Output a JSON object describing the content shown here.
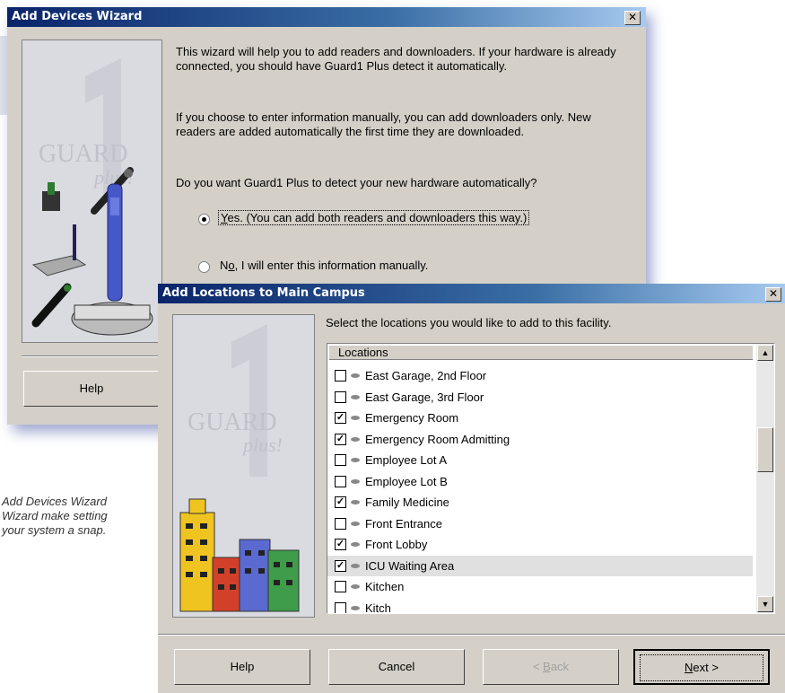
{
  "wizard": {
    "title": "Add Devices Wizard",
    "close_glyph": "✕",
    "para1": "This wizard will help you to add readers and downloaders.  If your hardware is already connected, you should have Guard1 Plus detect it automatically.",
    "para2": "If you choose to enter information manually, you can add downloaders only.  New readers are added automatically the first time they are downloaded.",
    "question": "Do you want Guard1 Plus to detect your new hardware automatically?",
    "option_yes": {
      "hotkey": "Y",
      "rest": "es.  (You can add both readers and downloaders this way.)",
      "selected": true
    },
    "option_no": {
      "prefix": "N",
      "hotkey": "o",
      "rest": ", I will enter this information manually.",
      "selected": false
    },
    "help_label": "Help",
    "logo_text": [
      "GUARD",
      "plus!"
    ]
  },
  "locations_dialog": {
    "title": "Add Locations to Main Campus",
    "close_glyph": "✕",
    "instruction": "Select the locations you would like to add to this facility.",
    "column_header": "Locations",
    "rows": [
      {
        "name": "East Garage, 2nd Floor",
        "checked": false
      },
      {
        "name": "East Garage, 3rd Floor",
        "checked": false
      },
      {
        "name": "Emergency Room",
        "checked": true
      },
      {
        "name": "Emergency Room Admitting",
        "checked": true
      },
      {
        "name": "Employee Lot A",
        "checked": false
      },
      {
        "name": "Employee Lot B",
        "checked": false
      },
      {
        "name": "Family Medicine",
        "checked": true
      },
      {
        "name": "Front Entrance",
        "checked": false
      },
      {
        "name": "Front Lobby",
        "checked": true
      },
      {
        "name": "ICU Waiting Area",
        "checked": true,
        "selected": true
      },
      {
        "name": "Kitchen",
        "checked": false
      },
      {
        "name": "Kitch",
        "checked": false
      }
    ],
    "buttons": {
      "help": "Help",
      "cancel": "Cancel",
      "back_prefix": "< ",
      "back_hotkey": "B",
      "back_rest": "ack",
      "next_hotkey": "N",
      "next_rest": "ext >"
    },
    "logo_text": [
      "GUARD",
      "plus!"
    ]
  },
  "caption": {
    "lines": [
      "Add Devices Wizard",
      "Wizard make setting",
      "your system a snap."
    ]
  },
  "colors": {
    "titlebar": "#0a246a",
    "dialog_face": "#d4d0c8"
  }
}
